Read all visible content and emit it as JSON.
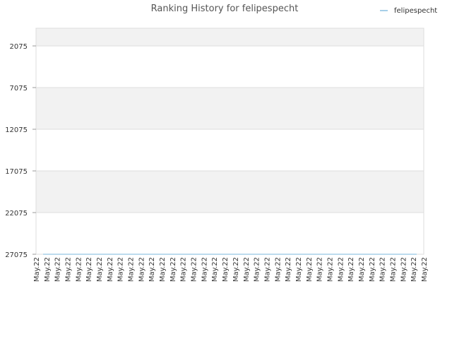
{
  "chart_data": {
    "type": "line",
    "title": "Ranking History for felipespecht",
    "xlabel": "",
    "ylabel": "",
    "ylim": [
      27075,
      2075
    ],
    "y_reversed": true,
    "y_ticks": [
      2075,
      7075,
      12075,
      17075,
      22075,
      27075
    ],
    "x_tick_labels": [
      "May.22",
      "May.22",
      "May.22",
      "May.22",
      "May.22",
      "May.22",
      "May.22",
      "May.22",
      "May.22",
      "May.22",
      "May.22",
      "May.22",
      "May.22",
      "May.22",
      "May.22",
      "May.22",
      "May.22",
      "May.22",
      "May.22",
      "May.22",
      "May.22",
      "May.22",
      "May.22",
      "May.22",
      "May.22",
      "May.22",
      "May.22",
      "May.22",
      "May.22",
      "May.22",
      "May.22",
      "May.22",
      "May.22",
      "May.22",
      "May.22",
      "May.22",
      "May.22",
      "May.22"
    ],
    "legend_position": "top-right",
    "grid": true,
    "series": [
      {
        "name": "felipespecht",
        "color": "#a6cfe8",
        "values": [
          27075,
          27075,
          27075,
          27075,
          27075,
          27075,
          27075,
          27075,
          27075,
          27075,
          27075,
          27075,
          27075,
          27075,
          27075,
          27075,
          27075,
          27075,
          27075,
          27075,
          27075,
          27075,
          27075,
          27075,
          27075,
          27075,
          27075,
          27075,
          27075,
          27075,
          27075,
          27075,
          27075,
          27075,
          27075,
          27075,
          27075
        ]
      }
    ]
  },
  "colors": {
    "band_fill": "#f2f2f2",
    "grid": "#dddddd",
    "border": "#dddddd"
  }
}
